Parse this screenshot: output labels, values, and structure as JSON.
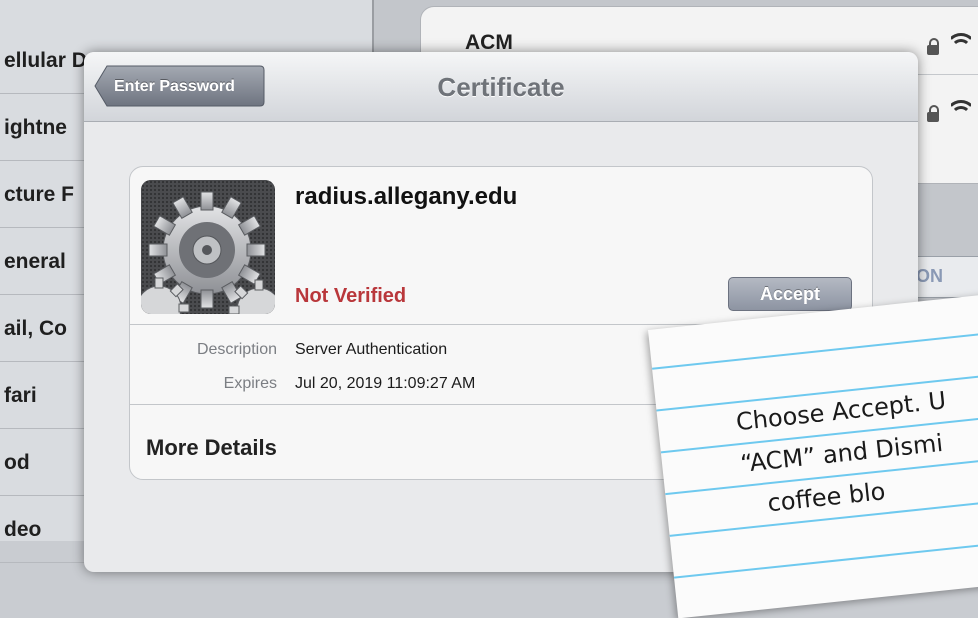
{
  "background": {
    "settings_items": [
      "ellular D",
      "ightne",
      "cture F",
      "eneral",
      "ail, Co",
      "fari",
      "od",
      "deo"
    ],
    "network_name": "ACM",
    "toggle_label": "ON"
  },
  "modal": {
    "back_label": "Enter Password",
    "title": "Certificate",
    "certificate": {
      "icon": "gear-icon",
      "domain": "radius.allegany.edu",
      "status": "Not Verified",
      "accept_label": "Accept",
      "details": [
        {
          "label": "Description",
          "value": "Server Authentication"
        },
        {
          "label": "Expires",
          "value": "Jul 20, 2019 11:09:27 AM"
        }
      ],
      "more_details": "More Details"
    }
  },
  "note": {
    "text": "Choose Accept. U\n“ACM” and Dismi\n   coffee blo"
  },
  "colors": {
    "status_red": "#b9373b",
    "note_line": "#6ec9ef"
  }
}
